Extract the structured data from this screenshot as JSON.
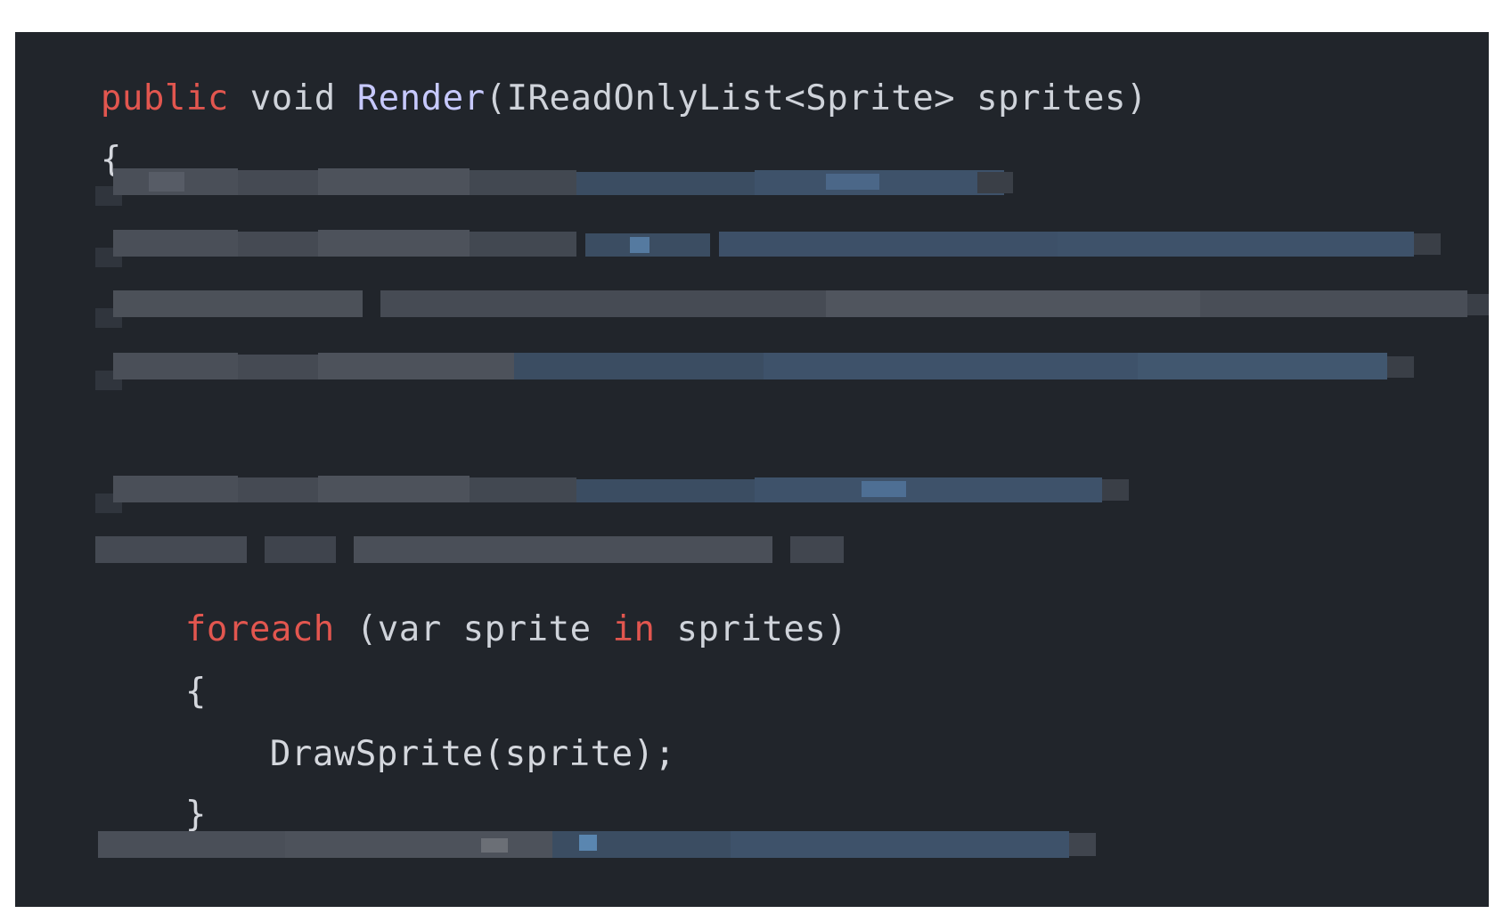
{
  "editor": {
    "theme_colors": {
      "background": "#21252b",
      "keyword_accent": "#e2564f",
      "function_name": "#c7c9ff",
      "default_text": "#cfd3da",
      "blur_gray": "#4a4f58",
      "blur_blue": "#3d5a7a"
    },
    "lines": [
      {
        "id": "signature",
        "tokens": {
          "public": "public",
          "void": " void ",
          "render": "Render",
          "params": "(IReadOnlyList<Sprite> sprites)"
        }
      },
      {
        "id": "open-brace",
        "text": "{"
      },
      {
        "id": "foreach",
        "tokens": {
          "foreach": "foreach",
          "paren_open_var": " (var sprite ",
          "in": "in",
          "rest": " sprites)"
        }
      },
      {
        "id": "foreach-open-brace",
        "text": "{"
      },
      {
        "id": "draw-call",
        "text": "DrawSprite(sprite);"
      },
      {
        "id": "foreach-close-brace",
        "text": "}"
      }
    ],
    "redacted_lines_count": 7
  }
}
